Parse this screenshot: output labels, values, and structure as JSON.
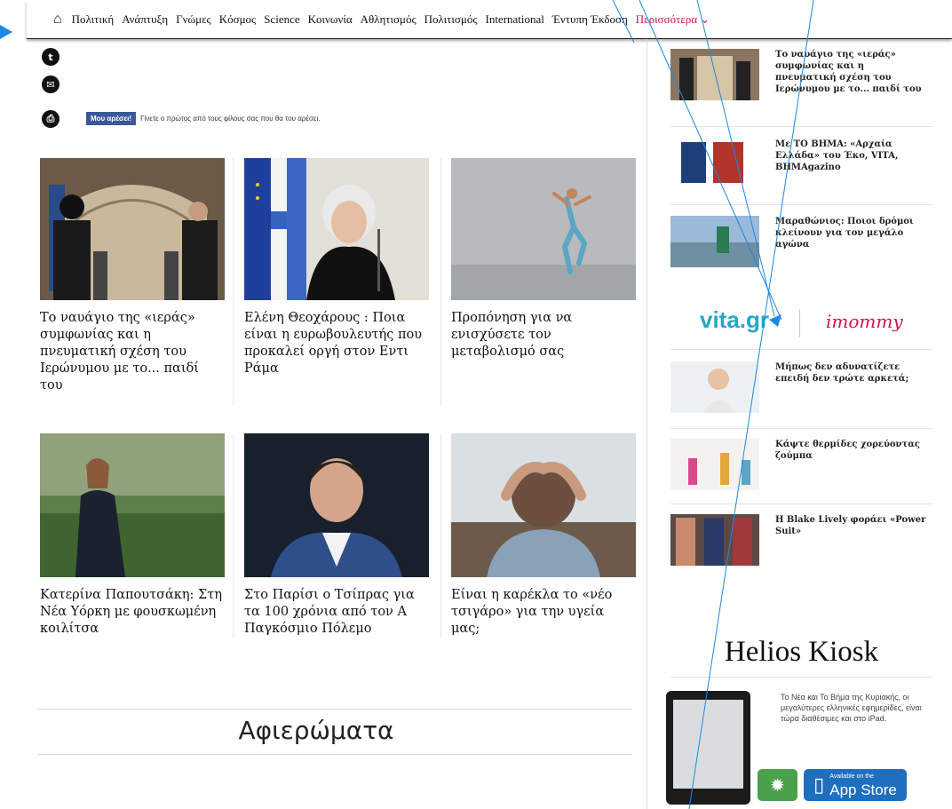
{
  "nav": {
    "items": [
      "Πολιτική",
      "Ανάπτυξη",
      "Γνώμες",
      "Κόσμος",
      "Science",
      "Κοινωνία",
      "Αθλητισμός",
      "Πολιτισμός",
      "International",
      "Έντυπη Έκδοση"
    ],
    "more": "Περισσότερα ⌄"
  },
  "share": {
    "icons": [
      "twitter-icon",
      "email-icon",
      "print-icon"
    ]
  },
  "facebook": {
    "button": "Μου αρέσει!",
    "text": "Γίνετε ο πρώτος από τους φίλους σας που θα του αρέσει."
  },
  "articles": [
    {
      "title": "Το ναυάγιο της «ιεράς» συμφωνίας και η πνευματική σχέση του Ιερώνυμου με το... παιδί του"
    },
    {
      "title": "Ελένη Θεοχάρους : Ποια είναι η ευρωβουλευτής που προκαλεί οργή στον Εντι Ράμα"
    },
    {
      "title": "Προπόνηση για να ενισχύσετε τον μεταβολισμό σας"
    },
    {
      "title": "Κατερίνα Παπουτσάκη: Στη Νέα Υόρκη με φουσκωμένη κοιλίτσα"
    },
    {
      "title": "Στο Παρίσι ο Τσίπρας για τα 100 χρόνια από τον Α Παγκόσμιο Πόλεμο"
    },
    {
      "title": "Είναι η καρέκλα το «νέο τσιγάρο» για την υγεία μας;"
    }
  ],
  "section": {
    "title": "Αφιερώματα"
  },
  "sidebar": {
    "top": [
      {
        "title": "Το ναυάγιο της «ιεράς» συμφωνίας και η πνευματική σχέση του Ιερώνυμου με το... παιδί του"
      },
      {
        "title": "Με ΤΟ ΒΗΜΑ: «Αρχαία Ελλάδα» του Έκο, VITA, ΒΗΜΑgazino"
      },
      {
        "title": "Μαραθώνιος: Ποιοι δρόμοι κλείνουν για τον μεγάλο αγώνα"
      }
    ],
    "partners": {
      "vita": "vita.gr",
      "mommy": "imommy"
    },
    "bottom": [
      {
        "title": "Μήπως δεν αδυνατίζετε επειδή δεν τρώτε αρκετά;"
      },
      {
        "title": "Κάψτε θερμίδες χορεύοντας ζούμπα"
      },
      {
        "title": "Η Blake Lively φοράει «Power Suit»"
      }
    ]
  },
  "kiosk": {
    "title": "Helios Kiosk",
    "text": "Το Νέα και Το Βήμα της Κυριακής, οι μεγαλύτερες ελληνικές εφημερίδες, είναι τώρα διαθέσιμες και στο iPad.",
    "badge_small": "Available on the",
    "badge_big": "App Store"
  },
  "colors": {
    "accent": "#d4124a",
    "facebook": "#3b5998",
    "annotation": "#1e88e5"
  }
}
